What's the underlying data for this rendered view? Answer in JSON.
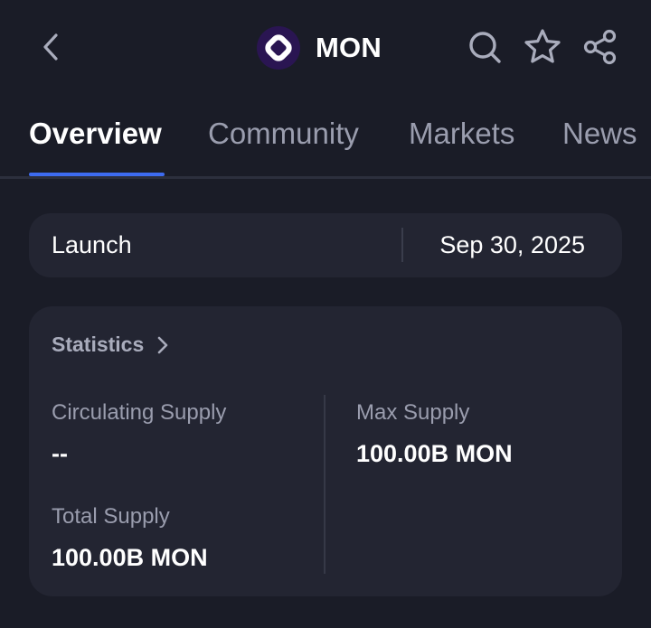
{
  "header": {
    "coin_name": "MON",
    "icons": {
      "back": "back-chevron-icon",
      "logo": "mon-logo-icon",
      "search": "search-icon",
      "favorite": "star-icon",
      "share": "share-icon"
    }
  },
  "tabs": [
    {
      "label": "Overview",
      "active": true
    },
    {
      "label": "Community",
      "active": false
    },
    {
      "label": "Markets",
      "active": false
    },
    {
      "label": "News",
      "active": false
    }
  ],
  "launch": {
    "label": "Launch",
    "value": "Sep 30, 2025"
  },
  "statistics": {
    "title": "Statistics",
    "circulating_supply": {
      "label": "Circulating Supply",
      "value": "--"
    },
    "total_supply": {
      "label": "Total Supply",
      "value": "100.00B MON"
    },
    "max_supply": {
      "label": "Max Supply",
      "value": "100.00B MON"
    }
  },
  "colors": {
    "background": "#1a1c27",
    "card": "#232532",
    "accent": "#3d6bf0",
    "muted_text": "#9a9dae"
  }
}
